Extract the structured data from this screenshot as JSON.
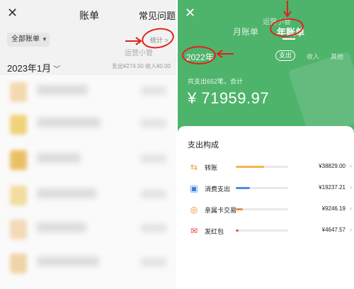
{
  "left": {
    "title": "账单",
    "faq": "常见问题",
    "filter_label": "全部账单",
    "watermark": "运营小管",
    "stats_label": "统计 >",
    "month": "2023年1月",
    "summary": "支出¥274.50  收入¥0.00"
  },
  "right": {
    "tab_month": "月账单",
    "tab_year": "年账单",
    "watermark": "运营小管",
    "year": "2022年",
    "type_expense": "支出",
    "type_income": "收入",
    "type_other": "其他",
    "count_text": "共支出652笔，合计",
    "total": "¥ 71959.97",
    "card_title": "支出构成",
    "categories": [
      {
        "name": "转账",
        "amount": "¥38829.00",
        "share": 0.54,
        "color": "#f0b84a",
        "icon": "transfer-icon",
        "glyph": "⇆",
        "glyph_color": "#f0a030"
      },
      {
        "name": "消费支出",
        "amount": "¥19237.21",
        "share": 0.27,
        "color": "#4a90e2",
        "icon": "wallet-icon",
        "glyph": "▣",
        "glyph_color": "#3b7fd9"
      },
      {
        "name": "亲属卡交易",
        "amount": "¥9246.19",
        "share": 0.13,
        "color": "#f08a3c",
        "icon": "family-card-icon",
        "glyph": "◎",
        "glyph_color": "#e8872f"
      },
      {
        "name": "发红包",
        "amount": "¥4647.57",
        "share": 0.06,
        "color": "#e35a4a",
        "icon": "red-packet-icon",
        "glyph": "✉",
        "glyph_color": "#e04a3a"
      }
    ]
  }
}
